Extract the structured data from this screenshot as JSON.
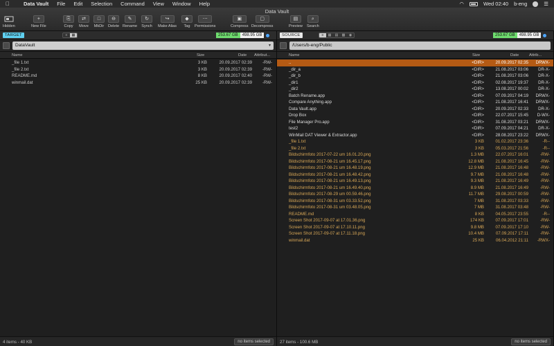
{
  "menubar": {
    "app_name": "Data Vault",
    "menus": [
      "File",
      "Edit",
      "Selection",
      "Command",
      "View",
      "Window",
      "Help"
    ],
    "clock": "Wed 02:40",
    "user": "b-eng"
  },
  "window": {
    "title": "Data Vault"
  },
  "toolbar": {
    "hidden": "Hidden",
    "new_file": "New File",
    "copy": "Copy",
    "move": "Move",
    "mkdir": "MkDir",
    "delete": "Delete",
    "rename": "Rename",
    "synch": "Synch",
    "make_alias": "Make Alias",
    "tag": "Tag",
    "permissions": "Permissions",
    "compress": "Compress",
    "decompress": "Decompress",
    "preview": "Preview",
    "search": "Search"
  },
  "left": {
    "role": "TARGET",
    "disk_free": "253.67 GB",
    "disk_total": "498.95 GB",
    "path": "DataVault",
    "columns": {
      "name": "Name",
      "size": "Size",
      "date": "Date",
      "attrib": "Attribut..."
    },
    "files": [
      {
        "name": "_file 1.txt",
        "size": "3 KB",
        "date": "20.09.2017 02:39",
        "attr": "-RW-"
      },
      {
        "name": "_file 2.txt",
        "size": "3 KB",
        "date": "20.09.2017 02:39",
        "attr": "-RW-"
      },
      {
        "name": "README.md",
        "size": "8 KB",
        "date": "20.09.2017 02:40",
        "attr": "-RW-"
      },
      {
        "name": "winmail.dat",
        "size": "25 KB",
        "date": "20.09.2017 02:39",
        "attr": "-RW-"
      }
    ],
    "status_count": "4 items - 40 KB",
    "selection_label": "no items selected"
  },
  "right": {
    "role": "SOURCE",
    "disk_free": "253.67 GB",
    "disk_total": "498.95 GB",
    "path": "/Users/b-eng/Public",
    "columns": {
      "name": "Name",
      "size": "Size",
      "date": "Date",
      "attrib": "Attrib..."
    },
    "files": [
      {
        "name": "..",
        "size": "<DIR>",
        "date": "20.09.2017 02:35",
        "attr": "DRWX-",
        "kind": "sel"
      },
      {
        "name": "_dir_a",
        "size": "<DIR>",
        "date": "21.08.2017 03:06",
        "attr": "DR-X-",
        "kind": "dir"
      },
      {
        "name": "_dir_b",
        "size": "<DIR>",
        "date": "21.08.2017 03:06",
        "attr": "DR-X-",
        "kind": "dir"
      },
      {
        "name": "_dir1",
        "size": "<DIR>",
        "date": "02.08.2017 19:37",
        "attr": "DR-X-",
        "kind": "dir"
      },
      {
        "name": "_dir2",
        "size": "<DIR>",
        "date": "13.08.2017 00:02",
        "attr": "DR-X-",
        "kind": "dir"
      },
      {
        "name": "Batch Rename.app",
        "size": "<DIR>",
        "date": "07.09.2017 04:19",
        "attr": "DRWX-",
        "kind": "dir"
      },
      {
        "name": "Compare Anything.app",
        "size": "<DIR>",
        "date": "21.08.2017 16:41",
        "attr": "DRWX-",
        "kind": "dir"
      },
      {
        "name": "Data Vault.app",
        "size": "<DIR>",
        "date": "20.09.2017 02:33",
        "attr": "DR-X-",
        "kind": "dir"
      },
      {
        "name": "Drop Box",
        "size": "<DIR>",
        "date": "22.07.2017 15:45",
        "attr": "D-WX-",
        "kind": "dir"
      },
      {
        "name": "File Manager Pro.app",
        "size": "<DIR>",
        "date": "31.08.2017 03:21",
        "attr": "DRWX-",
        "kind": "dir"
      },
      {
        "name": "test2",
        "size": "<DIR>",
        "date": "07.09.2017 04:21",
        "attr": "DR-X-",
        "kind": "dir"
      },
      {
        "name": "WinMail DAT Viewer & Extractor.app",
        "size": "<DIR>",
        "date": "28.08.2017 23:22",
        "attr": "DRWX-",
        "kind": "dir"
      },
      {
        "name": "_file 1.txt",
        "size": "3 KB",
        "date": "01.02.2017 23:36",
        "attr": "-R--",
        "kind": "file"
      },
      {
        "name": "_file 2.txt",
        "size": "3 KB",
        "date": "05.03.2017 21:56",
        "attr": "-R--",
        "kind": "file"
      },
      {
        "name": "Bildschirmfoto 2017-07-22 um 16.01.20.png",
        "size": "1.3 MB",
        "date": "22.07.2017 16:01",
        "attr": "-RW-",
        "kind": "file"
      },
      {
        "name": "Bildschirmfoto 2017-08-21 um 16.45.17.png",
        "size": "12.8 MB",
        "date": "21.08.2017 16:45",
        "attr": "-RW-",
        "kind": "file"
      },
      {
        "name": "Bildschirmfoto 2017-08-21 um 16.48.19.png",
        "size": "12.9 MB",
        "date": "21.08.2017 16:48",
        "attr": "-RW-",
        "kind": "file"
      },
      {
        "name": "Bildschirmfoto 2017-08-21 um 16.48.42.png",
        "size": "9.7 MB",
        "date": "21.08.2017 16:48",
        "attr": "-RW-",
        "kind": "file"
      },
      {
        "name": "Bildschirmfoto 2017-08-21 um 16.49.13.png",
        "size": "9.3 MB",
        "date": "21.08.2017 16:49",
        "attr": "-RW-",
        "kind": "file"
      },
      {
        "name": "Bildschirmfoto 2017-08-21 um 16.49.40.png",
        "size": "8.9 MB",
        "date": "21.08.2017 16:49",
        "attr": "-RW-",
        "kind": "file"
      },
      {
        "name": "Bildschirmfoto 2017-08-29 um 00.59.46.png",
        "size": "11.7 MB",
        "date": "29.08.2017 00:59",
        "attr": "-RW-",
        "kind": "file"
      },
      {
        "name": "Bildschirmfoto 2017-08-31 um 03.33.52.png",
        "size": "7 MB",
        "date": "31.08.2017 03:33",
        "attr": "-RW-",
        "kind": "file"
      },
      {
        "name": "Bildschirmfoto 2017-08-31 um 03.48.05.png",
        "size": "7 MB",
        "date": "31.08.2017 03:48",
        "attr": "-RW-",
        "kind": "file"
      },
      {
        "name": "README.md",
        "size": "8 KB",
        "date": "04.05.2017 23:55",
        "attr": "-R--",
        "kind": "file"
      },
      {
        "name": "Screen Shot 2017-09-07 at 17.01.36.png",
        "size": "174 KB",
        "date": "07.09.2017 17:01",
        "attr": "-RW-",
        "kind": "file"
      },
      {
        "name": "Screen Shot 2017-09-07 at 17.10.11.png",
        "size": "9.8 MB",
        "date": "07.09.2017 17:10",
        "attr": "-RW-",
        "kind": "file"
      },
      {
        "name": "Screen Shot 2017-09-07 at 17.11.18.png",
        "size": "10.4 MB",
        "date": "07.09.2017 17:11",
        "attr": "-RW-",
        "kind": "file"
      },
      {
        "name": "winmail.dat",
        "size": "25 KB",
        "date": "06.04.2012 21:11",
        "attr": "-RWX-",
        "kind": "file"
      }
    ],
    "status_count": "27 items - 100.6 MB",
    "selection_label": "no items selected"
  }
}
